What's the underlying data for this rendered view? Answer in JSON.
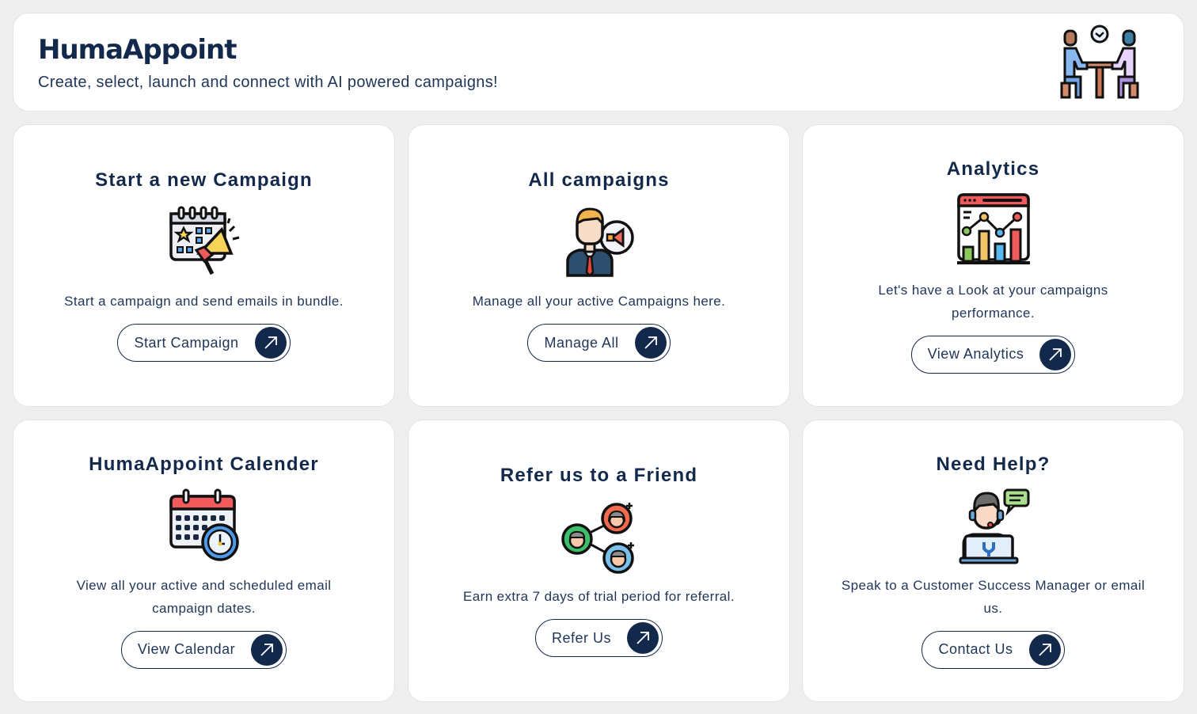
{
  "header": {
    "title": "HumaAppoint",
    "subtitle": "Create, select, launch and connect with AI powered campaigns!",
    "illustration": "meeting-table-icon"
  },
  "cards": [
    {
      "title": "Start a new Campaign",
      "icon": "calendar-megaphone-icon",
      "description": "Start a campaign and send emails in bundle.",
      "button_label": "Start Campaign"
    },
    {
      "title": "All campaigns",
      "icon": "businessman-megaphone-icon",
      "description": "Manage all your active Campaigns here.",
      "button_label": "Manage All"
    },
    {
      "title": "Analytics",
      "icon": "analytics-chart-icon",
      "description": "Let's have a Look at your campaigns performance.",
      "button_label": "View Analytics"
    },
    {
      "title": "HumaAppoint Calender",
      "icon": "calendar-clock-icon",
      "description": "View all your active and scheduled email campaign dates.",
      "button_label": "View Calendar"
    },
    {
      "title": "Refer us to a Friend",
      "icon": "referral-network-icon",
      "description": "Earn extra 7 days of trial period for referral.",
      "button_label": "Refer Us"
    },
    {
      "title": "Need Help?",
      "icon": "support-agent-icon",
      "description": "Speak to a Customer Success Manager or email us.",
      "button_label": "Contact Us"
    }
  ],
  "colors": {
    "primary": "#13294b",
    "background": "#efefef",
    "card": "#ffffff"
  }
}
